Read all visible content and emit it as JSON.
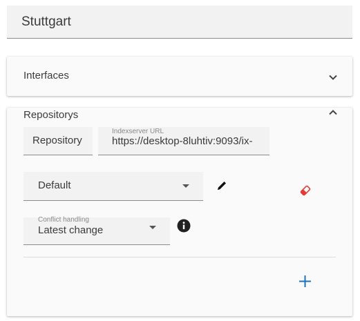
{
  "location": {
    "value": "Stuttgart"
  },
  "interfaces": {
    "title": "Interfaces"
  },
  "repositories": {
    "title": "Repositorys",
    "repository_field": {
      "value": "Repository"
    },
    "indexserver_field": {
      "label": "Indexserver URL",
      "value": "https://desktop-8luhtiv:9093/ix-"
    },
    "default_select": {
      "value": "Default"
    },
    "conflict_select": {
      "label": "Conflict handling",
      "value": "Latest change"
    }
  },
  "colors": {
    "eraser": "#e53935",
    "add": "#1e73be",
    "field_bg": "#f2f2f2",
    "panel_bg": "#fafafa"
  },
  "icons": {
    "expand": "chevron-down-icon",
    "collapse": "chevron-up-icon",
    "edit": "pencil-icon",
    "delete": "eraser-icon",
    "info": "info-icon",
    "add": "plus-icon"
  }
}
